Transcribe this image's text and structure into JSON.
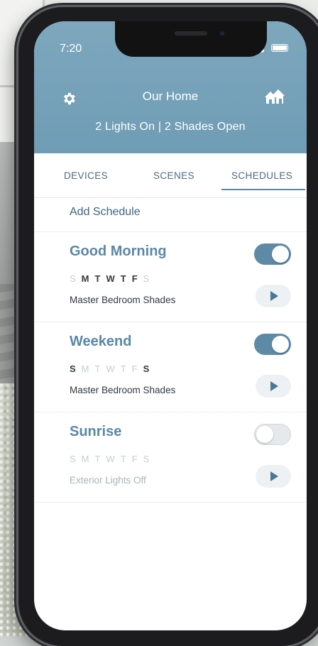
{
  "status_bar": {
    "time": "7:20"
  },
  "header": {
    "settings_icon": "gear-icon",
    "title": "Our Home",
    "home_icon": "house-icon",
    "summary": "2 Lights On | 2 Shades Open"
  },
  "tabs": [
    {
      "label": "DEVICES",
      "active": false
    },
    {
      "label": "SCENES",
      "active": false
    },
    {
      "label": "SCHEDULES",
      "active": true
    }
  ],
  "add_schedule_label": "Add Schedule",
  "schedules": [
    {
      "name": "Good Morning",
      "enabled": true,
      "days": [
        {
          "d": "S",
          "on": false
        },
        {
          "d": "M",
          "on": true
        },
        {
          "d": "T",
          "on": true
        },
        {
          "d": "W",
          "on": true
        },
        {
          "d": "T",
          "on": true
        },
        {
          "d": "F",
          "on": true
        },
        {
          "d": "S",
          "on": false
        }
      ],
      "device": "Master Bedroom Shades"
    },
    {
      "name": "Weekend",
      "enabled": true,
      "days": [
        {
          "d": "S",
          "on": true
        },
        {
          "d": "M",
          "on": false
        },
        {
          "d": "T",
          "on": false
        },
        {
          "d": "W",
          "on": false
        },
        {
          "d": "T",
          "on": false
        },
        {
          "d": "F",
          "on": false
        },
        {
          "d": "S",
          "on": true
        }
      ],
      "device": "Master Bedroom Shades"
    },
    {
      "name": "Sunrise",
      "enabled": false,
      "days": [
        {
          "d": "S",
          "on": false
        },
        {
          "d": "M",
          "on": true
        },
        {
          "d": "T",
          "on": true
        },
        {
          "d": "W",
          "on": true
        },
        {
          "d": "T",
          "on": true
        },
        {
          "d": "F",
          "on": true
        },
        {
          "d": "S",
          "on": false
        }
      ],
      "device": "Exterior Lights Off"
    }
  ],
  "colors": {
    "header": "#7ea7bd",
    "accent": "#5e8aa6",
    "text_dark": "#2f3a43"
  }
}
